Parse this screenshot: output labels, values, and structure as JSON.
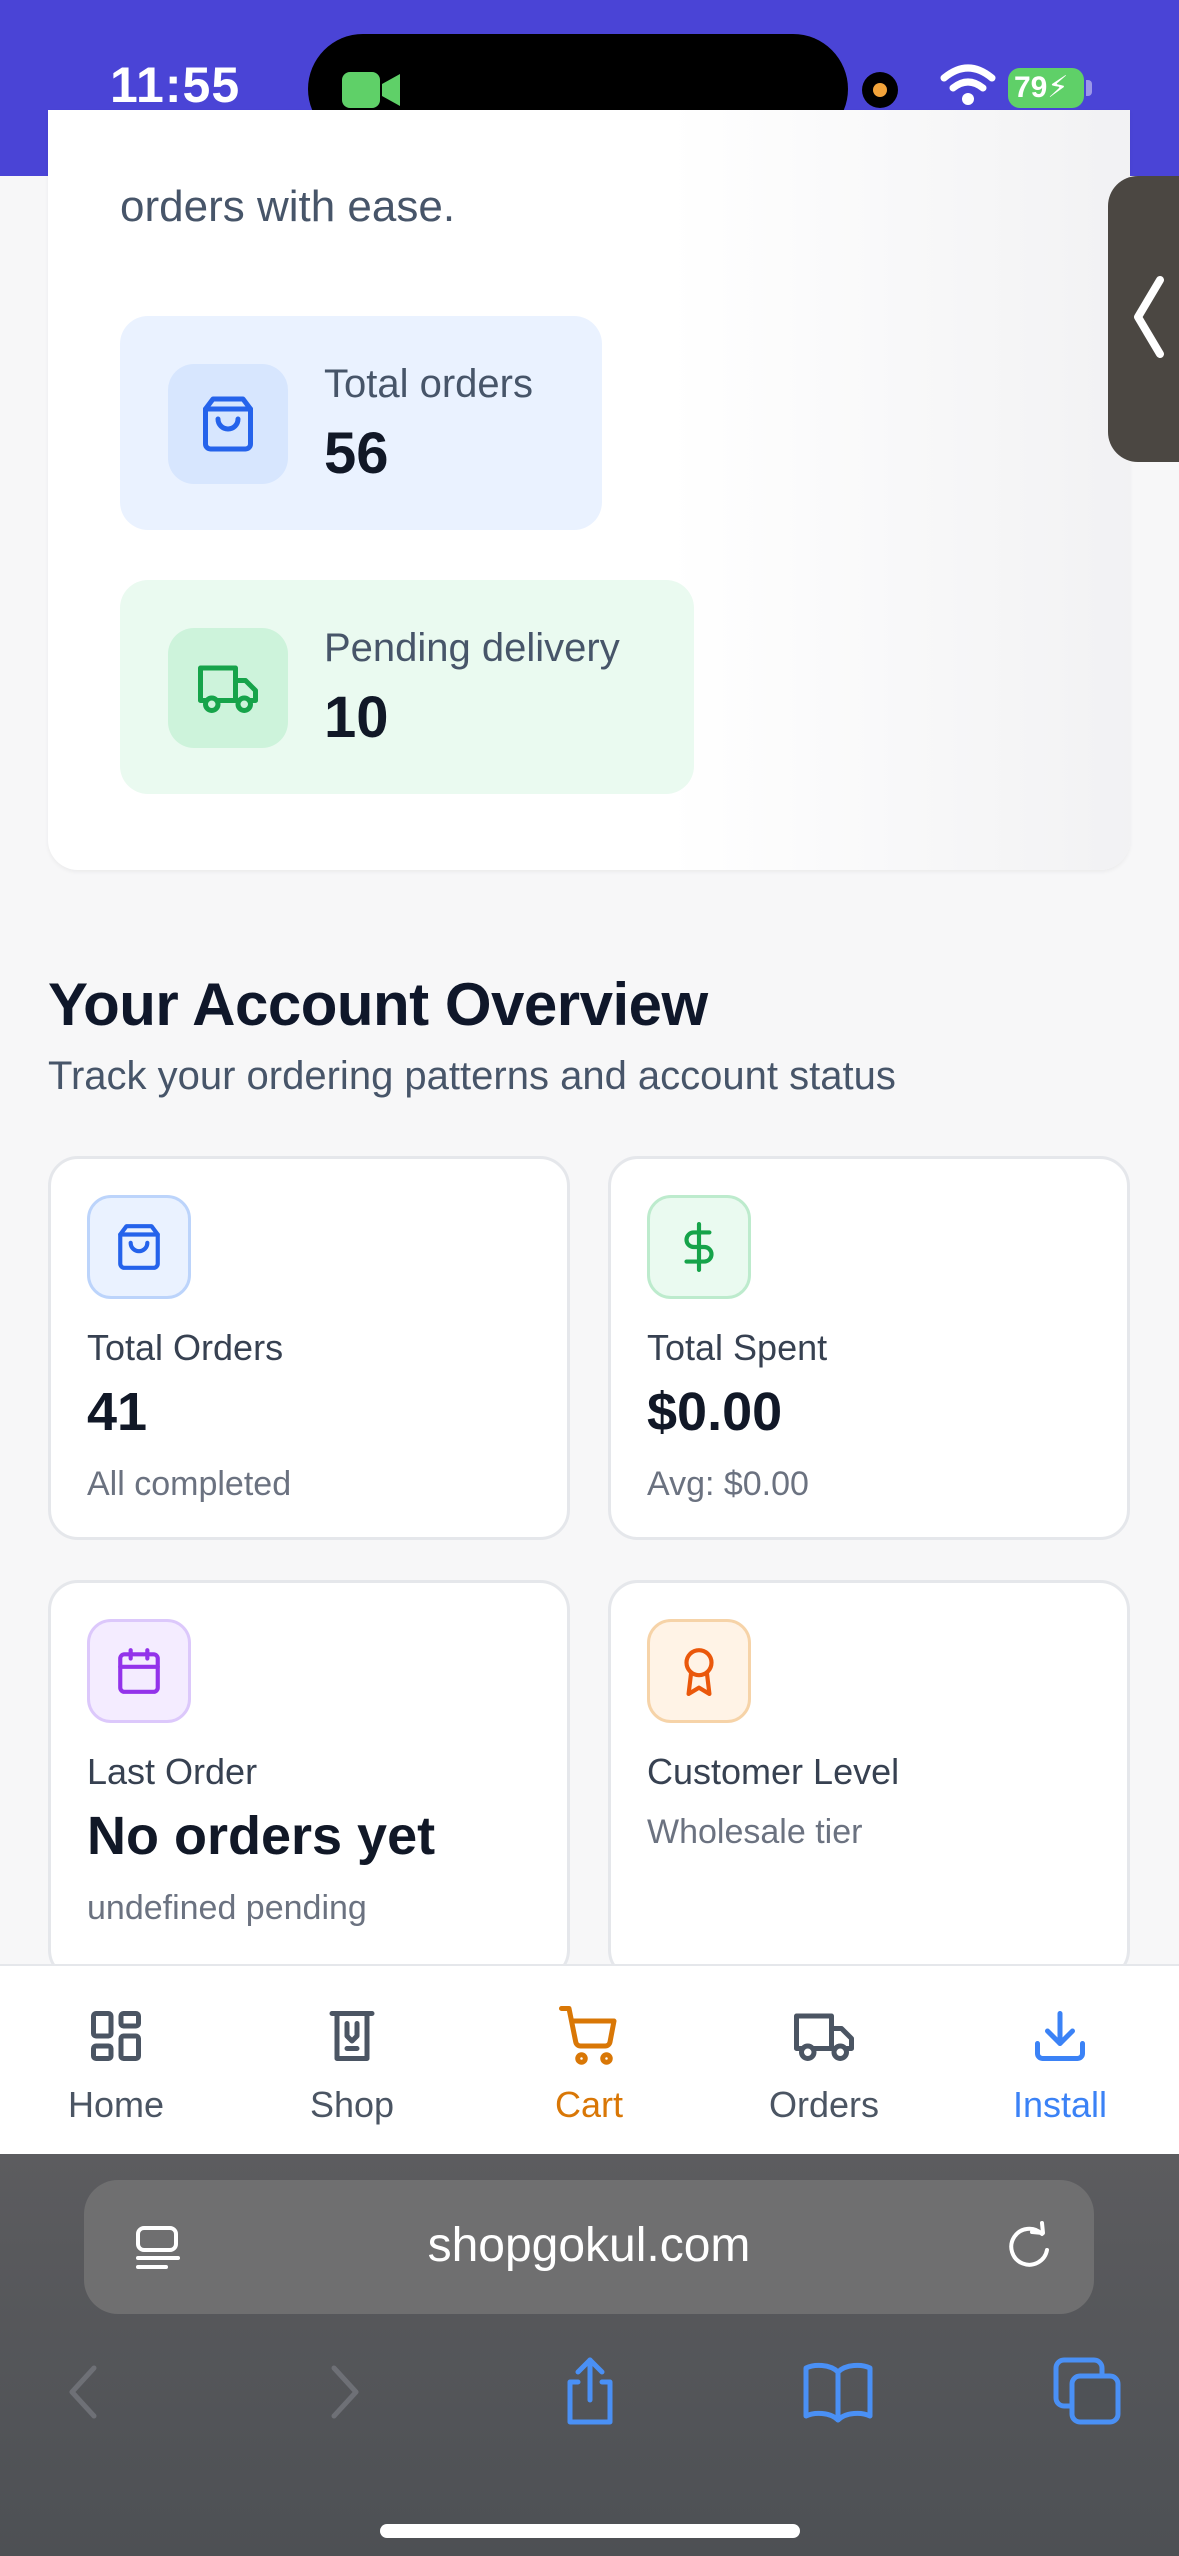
{
  "status_bar": {
    "time": "11:55",
    "battery": "79",
    "icons": [
      "facetime-camera-icon",
      "wifi-icon",
      "battery-charging-icon"
    ]
  },
  "hero": {
    "text": "orders with ease.",
    "stats": [
      {
        "label": "Total orders",
        "value": "56",
        "icon": "shopping-bag-icon",
        "color": "#2563eb"
      },
      {
        "label": "Pending delivery",
        "value": "10",
        "icon": "truck-icon",
        "color": "#16a34a"
      }
    ]
  },
  "overview": {
    "title": "Your Account Overview",
    "subtitle": "Track your ordering patterns and account status",
    "cards": [
      {
        "label": "Total Orders",
        "value": "41",
        "note": "All completed",
        "icon": "shopping-bag-icon",
        "color": "#2563eb"
      },
      {
        "label": "Total Spent",
        "value": "$0.00",
        "note": "Avg: $0.00",
        "icon": "dollar-icon",
        "color": "#16a34a"
      },
      {
        "label": "Last Order",
        "value": "No orders yet",
        "note": "undefined pending",
        "icon": "calendar-icon",
        "color": "#9333ea"
      },
      {
        "label": "Customer Level",
        "note": "Wholesale tier",
        "icon": "award-icon",
        "color": "#ea580c"
      }
    ]
  },
  "tabbar": {
    "items": [
      {
        "label": "Home",
        "icon": "grid-icon"
      },
      {
        "label": "Shop",
        "icon": "store-icon"
      },
      {
        "label": "Cart",
        "icon": "cart-icon",
        "color": "#d97706"
      },
      {
        "label": "Orders",
        "icon": "truck-icon"
      },
      {
        "label": "Install",
        "icon": "download-icon",
        "color": "#3b82f6"
      }
    ]
  },
  "browser": {
    "url": "shopgokul.com"
  }
}
